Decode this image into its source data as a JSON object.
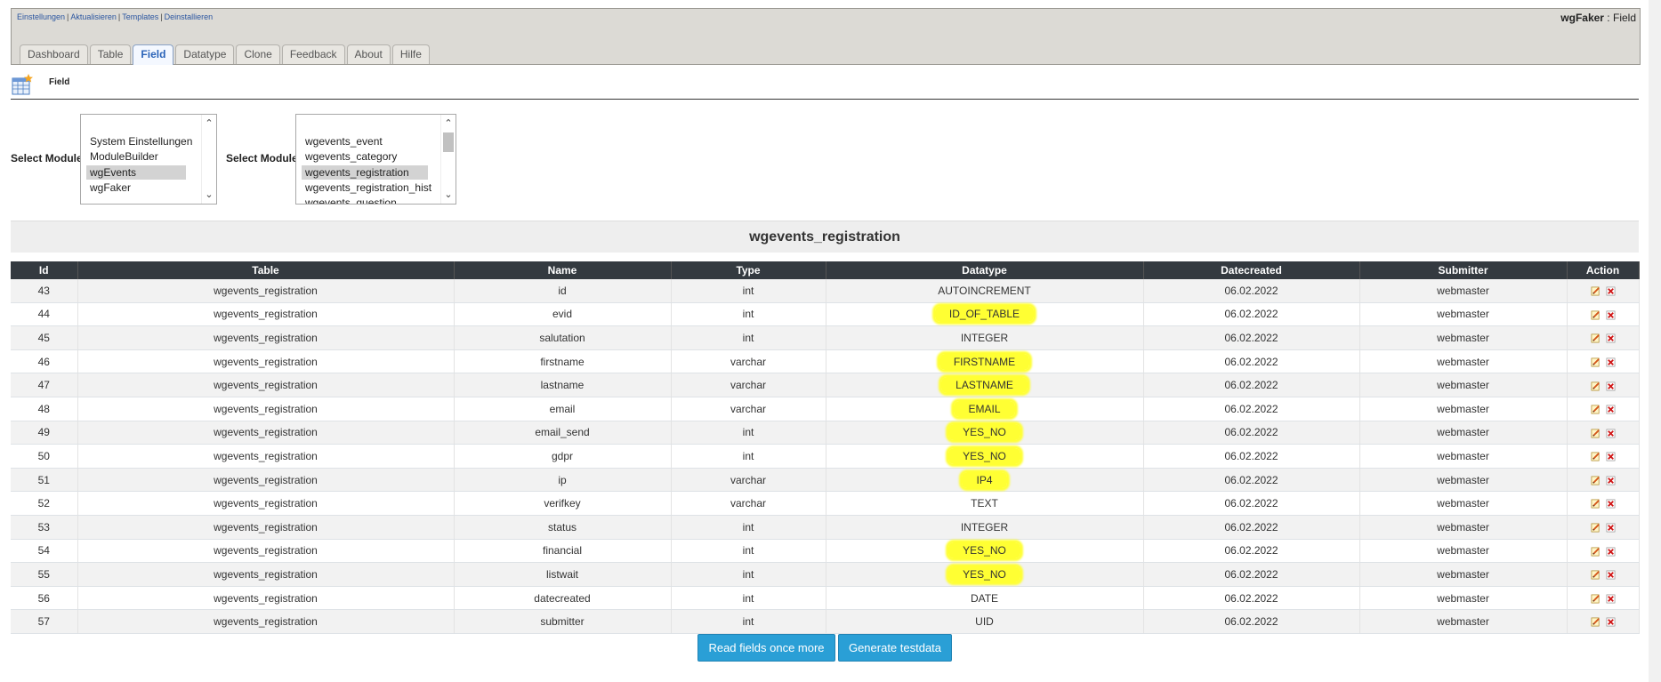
{
  "header": {
    "links": [
      "Einstellungen",
      "Aktualisieren",
      "Templates",
      "Deinstallieren"
    ],
    "module_name": "wgFaker",
    "module_sep": " : ",
    "section": "Field"
  },
  "tabs": [
    "Dashboard",
    "Table",
    "Field",
    "Datatype",
    "Clone",
    "Feedback",
    "About",
    "Hilfe"
  ],
  "active_tab": "Field",
  "page": {
    "heading": "Field",
    "icon": "table-star-icon"
  },
  "select1": {
    "label": "Select Module",
    "options": [
      "System Einstellungen",
      "ModuleBuilder",
      "wgEvents",
      "wgFaker"
    ],
    "selected": "wgEvents"
  },
  "select2": {
    "label": "Select Module",
    "options": [
      "wgevents_event",
      "wgevents_category",
      "wgevents_registration",
      "wgevents_registration_hist",
      "wgevents_question"
    ],
    "selected": "wgevents_registration"
  },
  "table": {
    "caption": "wgevents_registration",
    "headers": [
      "Id",
      "Table",
      "Name",
      "Type",
      "Datatype",
      "Datecreated",
      "Submitter",
      "Action"
    ],
    "rows": [
      {
        "id": "43",
        "table": "wgevents_registration",
        "name": "id",
        "type": "int",
        "datatype": "AUTOINCREMENT",
        "date": "06.02.2022",
        "submitter": "webmaster",
        "hl": false
      },
      {
        "id": "44",
        "table": "wgevents_registration",
        "name": "evid",
        "type": "int",
        "datatype": "ID_OF_TABLE",
        "date": "06.02.2022",
        "submitter": "webmaster",
        "hl": true
      },
      {
        "id": "45",
        "table": "wgevents_registration",
        "name": "salutation",
        "type": "int",
        "datatype": "INTEGER",
        "date": "06.02.2022",
        "submitter": "webmaster",
        "hl": false
      },
      {
        "id": "46",
        "table": "wgevents_registration",
        "name": "firstname",
        "type": "varchar",
        "datatype": "FIRSTNAME",
        "date": "06.02.2022",
        "submitter": "webmaster",
        "hl": true
      },
      {
        "id": "47",
        "table": "wgevents_registration",
        "name": "lastname",
        "type": "varchar",
        "datatype": "LASTNAME",
        "date": "06.02.2022",
        "submitter": "webmaster",
        "hl": true
      },
      {
        "id": "48",
        "table": "wgevents_registration",
        "name": "email",
        "type": "varchar",
        "datatype": "EMAIL",
        "date": "06.02.2022",
        "submitter": "webmaster",
        "hl": true
      },
      {
        "id": "49",
        "table": "wgevents_registration",
        "name": "email_send",
        "type": "int",
        "datatype": "YES_NO",
        "date": "06.02.2022",
        "submitter": "webmaster",
        "hl": true
      },
      {
        "id": "50",
        "table": "wgevents_registration",
        "name": "gdpr",
        "type": "int",
        "datatype": "YES_NO",
        "date": "06.02.2022",
        "submitter": "webmaster",
        "hl": true
      },
      {
        "id": "51",
        "table": "wgevents_registration",
        "name": "ip",
        "type": "varchar",
        "datatype": "IP4",
        "date": "06.02.2022",
        "submitter": "webmaster",
        "hl": true
      },
      {
        "id": "52",
        "table": "wgevents_registration",
        "name": "verifkey",
        "type": "varchar",
        "datatype": "TEXT",
        "date": "06.02.2022",
        "submitter": "webmaster",
        "hl": false
      },
      {
        "id": "53",
        "table": "wgevents_registration",
        "name": "status",
        "type": "int",
        "datatype": "INTEGER",
        "date": "06.02.2022",
        "submitter": "webmaster",
        "hl": false
      },
      {
        "id": "54",
        "table": "wgevents_registration",
        "name": "financial",
        "type": "int",
        "datatype": "YES_NO",
        "date": "06.02.2022",
        "submitter": "webmaster",
        "hl": true
      },
      {
        "id": "55",
        "table": "wgevents_registration",
        "name": "listwait",
        "type": "int",
        "datatype": "YES_NO",
        "date": "06.02.2022",
        "submitter": "webmaster",
        "hl": true
      },
      {
        "id": "56",
        "table": "wgevents_registration",
        "name": "datecreated",
        "type": "int",
        "datatype": "DATE",
        "date": "06.02.2022",
        "submitter": "webmaster",
        "hl": false
      },
      {
        "id": "57",
        "table": "wgevents_registration",
        "name": "submitter",
        "type": "int",
        "datatype": "UID",
        "date": "06.02.2022",
        "submitter": "webmaster",
        "hl": false
      }
    ],
    "action_icons": [
      "edit-icon",
      "delete-icon"
    ]
  },
  "buttons": {
    "read_fields": "Read fields once more",
    "generate": "Generate testdata"
  },
  "colors": {
    "highlight": "#ffff33",
    "button": "#2a9fd6",
    "table_header": "#343a40",
    "tab_active_text": "#2a63b8"
  }
}
